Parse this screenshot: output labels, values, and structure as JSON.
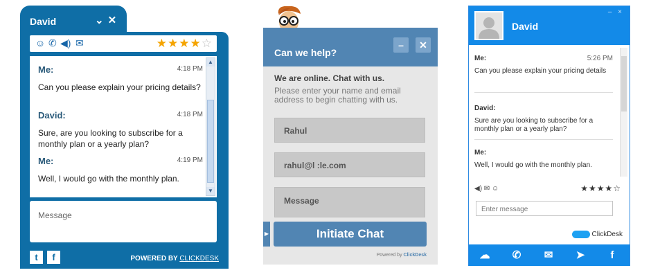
{
  "widget1": {
    "agent_name": "David",
    "controls": {
      "minimize": "⌄",
      "close": "✕"
    },
    "icons": [
      "smiley-icon",
      "phone-icon",
      "speaker-icon",
      "mail-icon"
    ],
    "rating": {
      "filled": 4,
      "total": 5
    },
    "messages": [
      {
        "from": "Me:",
        "time": "4:18 PM",
        "text": "Can you please explain your pricing details?"
      },
      {
        "from": "David:",
        "time": "4:18 PM",
        "text": "Sure, are you looking to subscribe for a monthly plan or a yearly plan?"
      },
      {
        "from": "Me:",
        "time": "4:19 PM",
        "text": "Well, I would go with the monthly plan."
      }
    ],
    "input_placeholder": "Message",
    "powered_prefix": "POWERED BY ",
    "powered_link": "CLICKDESK",
    "social": [
      "twitter-icon",
      "facebook-icon"
    ]
  },
  "widget2": {
    "title": "Can we help?",
    "buttons": {
      "minimize": "–",
      "close": "✕"
    },
    "online_title": "We are online. Chat with us.",
    "online_sub": "Please enter your name and email address to begin chatting with us.",
    "name_value": "Rahul",
    "email_value": "rahul@l         :le.com",
    "message_placeholder": "Message",
    "submit_label": "Initiate Chat",
    "powered_prefix": "Powered by ",
    "powered_brand": "ClickDesk"
  },
  "widget3": {
    "agent_name": "David",
    "window_controls": "– ×",
    "messages": [
      {
        "from": "Me:",
        "time": "5:26 PM",
        "text": "Can you please explain your pricing details"
      },
      {
        "from": "David:",
        "time": "",
        "text": "Sure are you looking to subscribe for a monthly plan or a yearly plan?"
      },
      {
        "from": "Me:",
        "time": "",
        "text": "Well, I would go with the monthly plan."
      }
    ],
    "tools": "◀) ✉ ☺",
    "stars": "★★★★☆",
    "input_placeholder": "Enter message",
    "brand": "ClickDesk",
    "bottom_icons": [
      "chat-icon",
      "phone-icon",
      "mail-icon",
      "twitter-icon",
      "facebook-icon"
    ]
  }
}
